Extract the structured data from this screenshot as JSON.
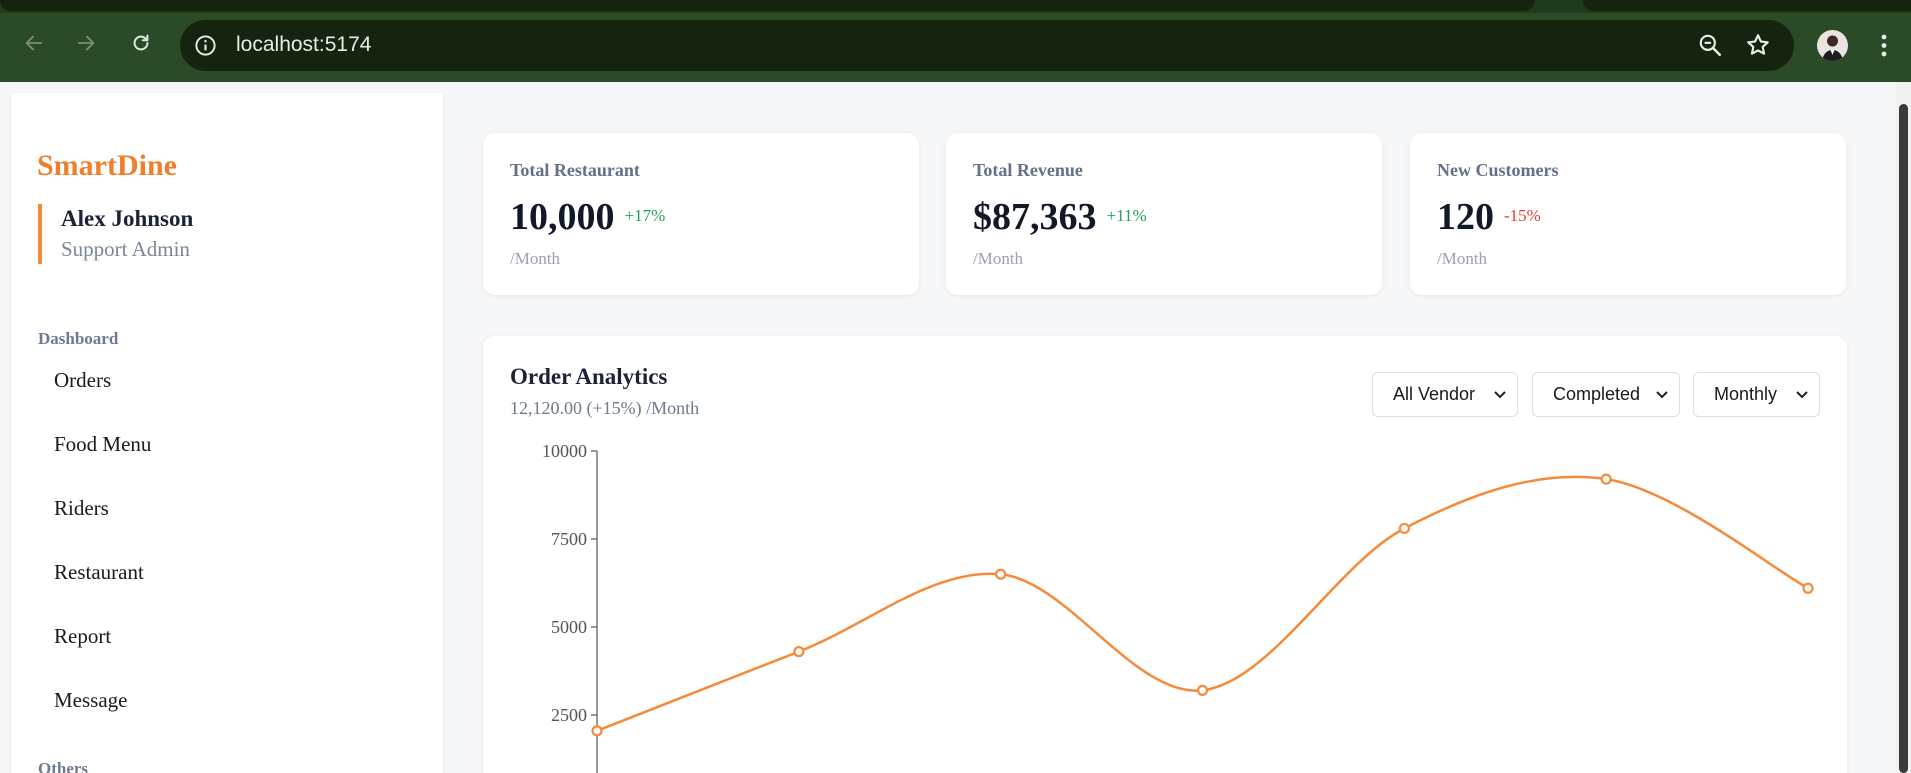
{
  "browser": {
    "url": "localhost:5174"
  },
  "sidebar": {
    "brand": "SmartDine",
    "profile": {
      "name": "Alex Johnson",
      "role": "Support Admin"
    },
    "sections": [
      {
        "label": "Dashboard",
        "items": [
          "Orders",
          "Food Menu",
          "Riders",
          "Restaurant",
          "Report",
          "Message"
        ]
      },
      {
        "label": "Others"
      }
    ]
  },
  "stats": [
    {
      "title": "Total Restaurant",
      "value": "10,000",
      "change": "+17%",
      "trend": "up",
      "period": "/Month"
    },
    {
      "title": "Total Revenue",
      "value": "$87,363",
      "change": "+11%",
      "trend": "up",
      "period": "/Month"
    },
    {
      "title": "New Customers",
      "value": "120",
      "change": "-15%",
      "trend": "down",
      "period": "/Month"
    }
  ],
  "analytics": {
    "title": "Order Analytics",
    "subtitle": "12,120.00 (+15%) /Month",
    "filters": {
      "vendor": "All Vendor",
      "status": "Completed",
      "period": "Monthly"
    }
  },
  "colors": {
    "accent": "#f58a3a",
    "positive": "#22a05a",
    "negative": "#e03b3b",
    "chrome": "#2b4a27"
  },
  "chart_data": {
    "type": "line",
    "title": "",
    "xlabel": "",
    "ylabel": "",
    "y_ticks": [
      "10000",
      "7500",
      "5000",
      "2500"
    ],
    "ylim": [
      0,
      10000
    ],
    "x": [
      1,
      2,
      3,
      4,
      5,
      6,
      7
    ],
    "values": [
      2050,
      4300,
      6500,
      3200,
      7800,
      9200,
      6100
    ],
    "curve": "smooth",
    "grid": false,
    "color": "#f58a3a"
  }
}
